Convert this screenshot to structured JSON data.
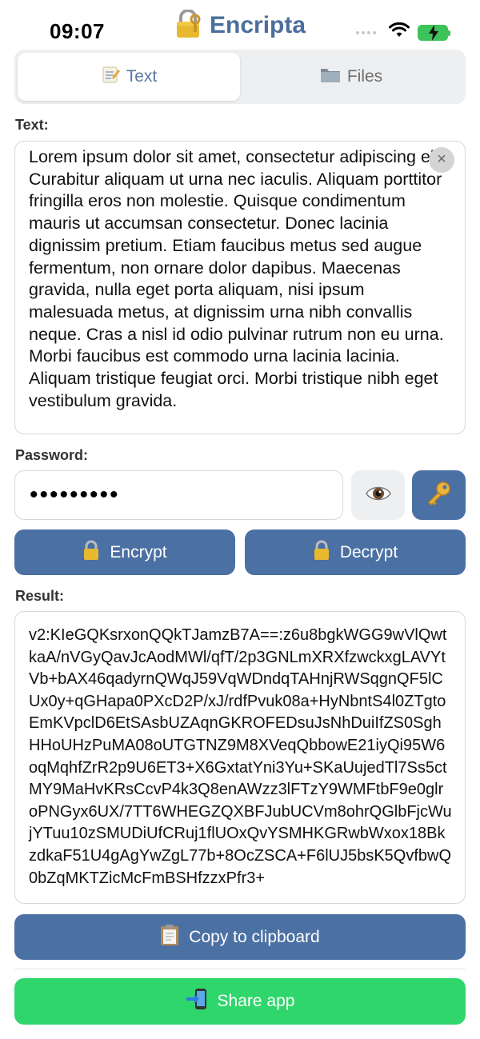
{
  "status_bar": {
    "time": "09:07",
    "icons": [
      "signal-dots-icon",
      "wifi-icon",
      "battery-charging-icon"
    ]
  },
  "app": {
    "title": "Encripta",
    "title_icon": "lock-with-key-icon",
    "accent_color": "#4b70a3",
    "title_color": "#4a6f9e"
  },
  "tabs": [
    {
      "label": "Text",
      "icon": "memo-icon",
      "selected": true
    },
    {
      "label": "Files",
      "icon": "folder-icon",
      "selected": false
    }
  ],
  "text_section": {
    "label": "Text:",
    "value": "Lorem ipsum dolor sit amet, consectetur adipiscing elit. Curabitur aliquam ut urna nec iaculis. Aliquam porttitor fringilla eros non molestie. Quisque condimentum mauris ut accumsan consectetur. Donec lacinia dignissim pretium. Etiam faucibus metus sed augue fermentum, non ornare dolor dapibus. Maecenas gravida, nulla eget porta aliquam, nisi ipsum malesuada metus, at dignissim urna nibh convallis neque. Cras a nisl id odio pulvinar rutrum non eu urna. Morbi faucibus est commodo urna lacinia lacinia. Aliquam tristique feugiat orci. Morbi tristique nibh eget vestibulum gravida.",
    "clear_symbol": "×"
  },
  "password_section": {
    "label": "Password:",
    "masked_value": "•••••••••"
  },
  "actions": {
    "encrypt_label": "Encrypt",
    "decrypt_label": "Decrypt"
  },
  "result_section": {
    "label": "Result:",
    "value": "v2:KIeGQKsrxonQQkTJamzB7A==:z6u8bgkWGG9wVlQwtkaA/nVGyQavJcAodMWl/qfT/2p3GNLmXRXfzwckxgLAVYtVb+bAX46qadyrnQWqJ59VqWDndqTAHnjRWSqgnQF5lCUx0y+qGHapa0PXcD2P/xJ/rdfPvuk08a+HyNbntS4l0ZTgtoEmKVpclD6EtSAsbUZAqnGKROFEDsuJsNhDuiIfZS0SghHHoUHzPuMA08oUTGTNZ9M8XVeqQbbowE21iyQi95W6oqMqhfZrR2p9U6ET3+X6GxtatYni3Yu+SKaUujedTl7Ss5ctMY9MaHvKRsCcvP4k3Q8enAWzz3lFTzY9WMFtbF9e0glroPNGyx6UX/7TT6WHEGZQXBFJubUCVm8ohrQGlbFjcWujYTuu10zSMUDiUfCRuj1flUOxQvYSMHKGRwbWxox18BkzdkaF51U4gAgYwZgL77b+8OcZSCA+F6lUJ5bsK5QvfbwQ0bZqMKTZicMcFmBSHfzzxPfr3+"
  },
  "copy_label": "Copy to clipboard",
  "share_label": "Share app"
}
